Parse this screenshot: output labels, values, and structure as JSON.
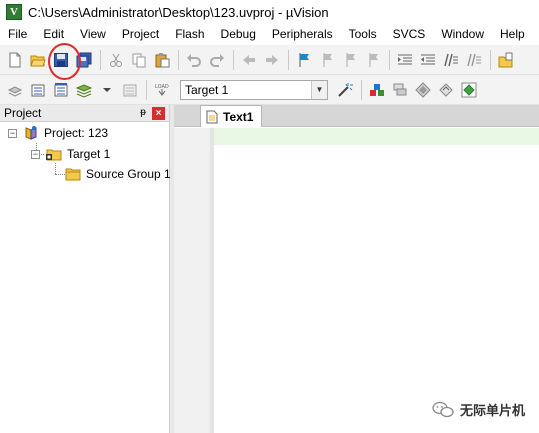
{
  "window": {
    "title": "C:\\Users\\Administrator\\Desktop\\123.uvproj - µVision",
    "app_icon_letter": "V"
  },
  "menu": {
    "items": [
      "File",
      "Edit",
      "View",
      "Project",
      "Flash",
      "Debug",
      "Peripherals",
      "Tools",
      "SVCS",
      "Window",
      "Help"
    ]
  },
  "toolbar_build": {
    "target_selected": "Target 1"
  },
  "project_panel": {
    "title": "Project",
    "pin_glyph": "ᵽ",
    "close_glyph": "×",
    "tree": {
      "root_label": "Project: 123",
      "target_label": "Target 1",
      "group_label": "Source Group 1",
      "expander_glyph": "−"
    }
  },
  "editor": {
    "tabs": [
      "Text1"
    ]
  },
  "watermark": {
    "text": "无际单片机"
  },
  "colors": {
    "annotation": "#e02a2a",
    "current_line": "#e8f7e4",
    "close_button": "#d32f2f"
  }
}
